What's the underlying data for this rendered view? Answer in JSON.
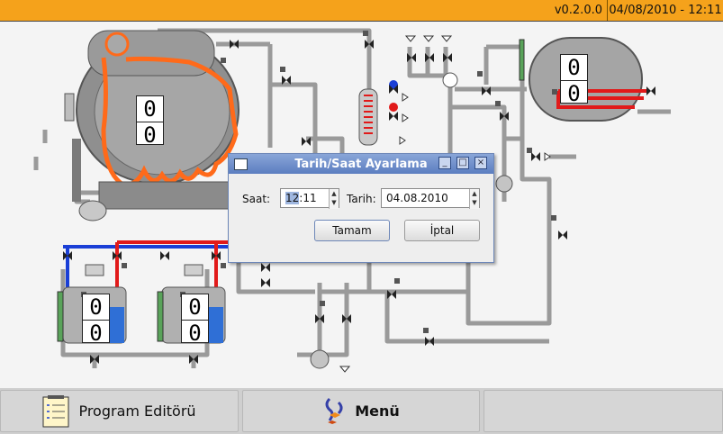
{
  "header": {
    "version": "v0.2.0.0",
    "datetime": "04/08/2010 - 12:11"
  },
  "machine": {
    "main_counter": [
      "0",
      "0"
    ],
    "tank_counter": [
      "0",
      "0"
    ],
    "left_counter": [
      "0",
      "0"
    ],
    "right_counter": [
      "0",
      "0"
    ]
  },
  "dialog": {
    "title": "Tarih/Saat Ayarlama",
    "time_label": "Saat:",
    "time_hours": "12",
    "time_minutes": ":11",
    "date_label": "Tarih:",
    "date_value": "04.08.2010",
    "ok_label": "Tamam",
    "cancel_label": "İptal"
  },
  "footer": {
    "program_editor_label": "Program Editörü",
    "menu_label": "Menü"
  },
  "colors": {
    "header": "#f5a21b",
    "hot_line": "#e11a1a",
    "cold_line": "#1a3fd6",
    "heating_coil": "#ff6a1a",
    "water": "#2f6fd6"
  }
}
